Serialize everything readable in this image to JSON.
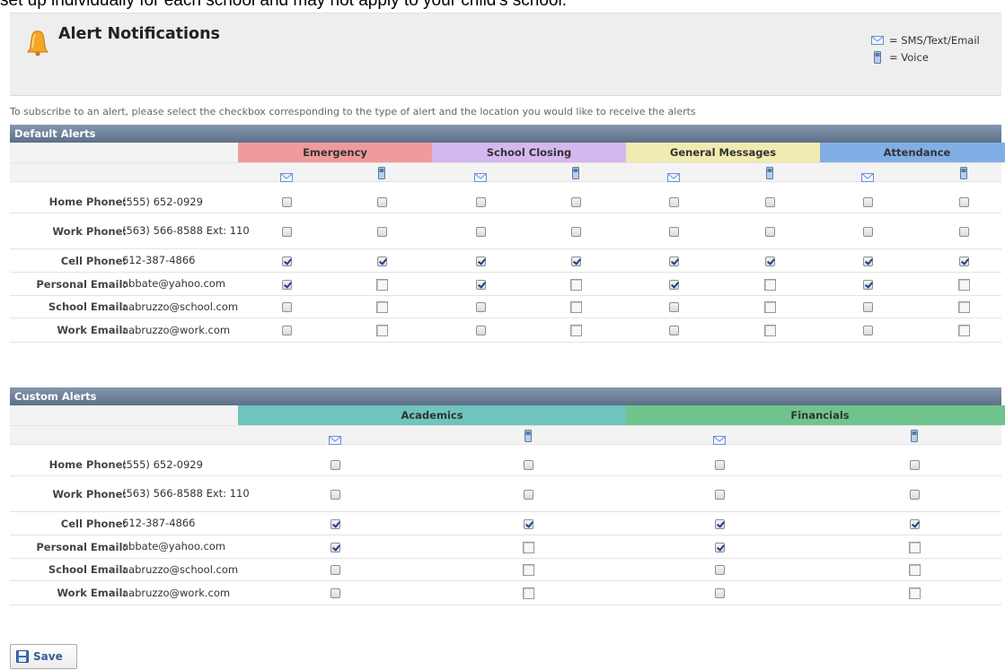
{
  "top_text": "set up individually for each school and may not apply to your child's school.",
  "title": "Alert Notifications",
  "legend": {
    "sms": "= SMS/Text/Email",
    "voice": "= Voice"
  },
  "instructions": "To subscribe to an alert, please select the checkbox corresponding to the type of alert and the location you would like to receive the alerts",
  "colors": {
    "emergency": "#f09b9b",
    "school_closing": "#d4b8ee",
    "general_messages": "#f0ebb0",
    "attendance": "#82aee6",
    "academics": "#6fc4bd",
    "financials": "#6fc48d"
  },
  "default_alerts": {
    "heading": "Default Alerts",
    "categories": [
      "Emergency",
      "School Closing",
      "General Messages",
      "Attendance"
    ]
  },
  "custom_alerts": {
    "heading": "Custom Alerts",
    "categories": [
      "Academics",
      "Financials"
    ]
  },
  "contacts": [
    {
      "label": "Home Phone:",
      "value": "(555) 652-0929"
    },
    {
      "label": "Work Phone:",
      "value": "(563) 566-8588 Ext: 110"
    },
    {
      "label": "Cell Phone:",
      "value": "612-387-4866"
    },
    {
      "label": "Personal Email:",
      "value": "abbate@yahoo.com"
    },
    {
      "label": "School Email:",
      "value": "aabruzzo@school.com"
    },
    {
      "label": "Work Email:",
      "value": "aabruzzo@work.com"
    }
  ],
  "default_checked": [
    [
      false,
      false,
      false,
      false,
      false,
      false,
      false,
      false
    ],
    [
      false,
      false,
      false,
      false,
      false,
      false,
      false,
      false
    ],
    [
      true,
      true,
      true,
      true,
      true,
      true,
      true,
      true
    ],
    [
      true,
      false,
      true,
      false,
      true,
      false,
      true,
      false
    ],
    [
      false,
      false,
      false,
      false,
      false,
      false,
      false,
      false
    ],
    [
      false,
      false,
      false,
      false,
      false,
      false,
      false,
      false
    ]
  ],
  "custom_checked": [
    [
      false,
      false,
      false,
      false
    ],
    [
      false,
      false,
      false,
      false
    ],
    [
      true,
      true,
      true,
      true
    ],
    [
      true,
      false,
      true,
      false
    ],
    [
      false,
      false,
      false,
      false
    ],
    [
      false,
      false,
      false,
      false
    ]
  ],
  "save_label": "Save",
  "icons": {
    "sms": "envelope-icon",
    "voice": "phone-icon",
    "bell": "bell-icon",
    "save": "floppy-icon"
  }
}
